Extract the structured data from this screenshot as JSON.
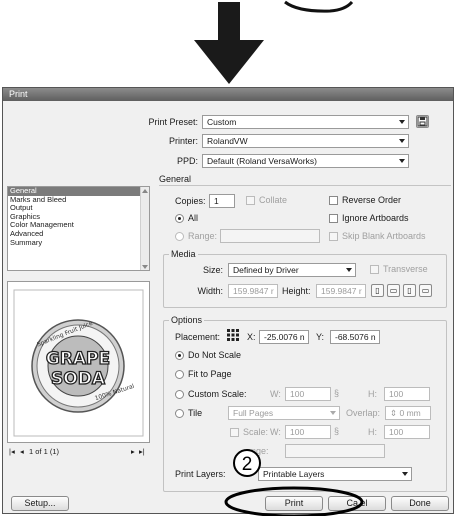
{
  "dialog": {
    "title": "Print",
    "print_preset": {
      "label": "Print Preset:",
      "value": "Custom"
    },
    "printer": {
      "label": "Printer:",
      "value": "RolandVW"
    },
    "ppd": {
      "label": "PPD:",
      "value": "Default (Roland VersaWorks)"
    },
    "categories": [
      "General",
      "Marks and Bleed",
      "Output",
      "Graphics",
      "Color Management",
      "Advanced",
      "Summary"
    ],
    "selected_category": "General",
    "page_nav": "1 of 1 (1)",
    "general": {
      "heading": "General",
      "copies_label": "Copies:",
      "copies_value": "1",
      "collate": "Collate",
      "reverse_order": "Reverse Order",
      "all": "All",
      "range": "Range:",
      "ignore_artboards": "Ignore Artboards",
      "skip_blank": "Skip Blank Artboards"
    },
    "media": {
      "heading": "Media",
      "size_label": "Size:",
      "size_value": "Defined by Driver",
      "transverse": "Transverse",
      "width_label": "Width:",
      "width_value": "159.9847 r",
      "height_label": "Height:",
      "height_value": "159.9847 r"
    },
    "options": {
      "heading": "Options",
      "placement_label": "Placement:",
      "x_label": "X:",
      "x_value": "-25.0076 n",
      "y_label": "Y:",
      "y_value": "-68.5076 n",
      "do_not_scale": "Do Not Scale",
      "fit_to_page": "Fit to Page",
      "custom_scale": "Custom Scale:",
      "w_label": "W:",
      "w_value": "100",
      "h_label": "H:",
      "h_value": "100",
      "tile": "Tile",
      "tile_value": "Full Pages",
      "overlap_label": "Overlap:",
      "overlap_value": "0 mm",
      "scale_label": "Scale:",
      "scale_w_label": "W:",
      "scale_w_value": "100",
      "scale_h_label": "H:",
      "scale_h_value": "100",
      "tile_range": "nge:"
    },
    "print_layers": {
      "label": "Print Layers:",
      "value": "Printable Layers"
    },
    "buttons": {
      "setup": "Setup...",
      "print": "Print",
      "cancel": "Ca    el",
      "done": "Done"
    }
  },
  "preview_art": {
    "top_text": "Sparkling Fruit Juice",
    "word1": "GRAPE",
    "word2": "SODA",
    "bottom_text": "100% Natural"
  },
  "annotation": {
    "step_number": "2"
  },
  "colors": {
    "highlight": "#7b7b7b",
    "dialog_bg": "#f0f0f0",
    "titlebar": "#6e6e6e"
  }
}
